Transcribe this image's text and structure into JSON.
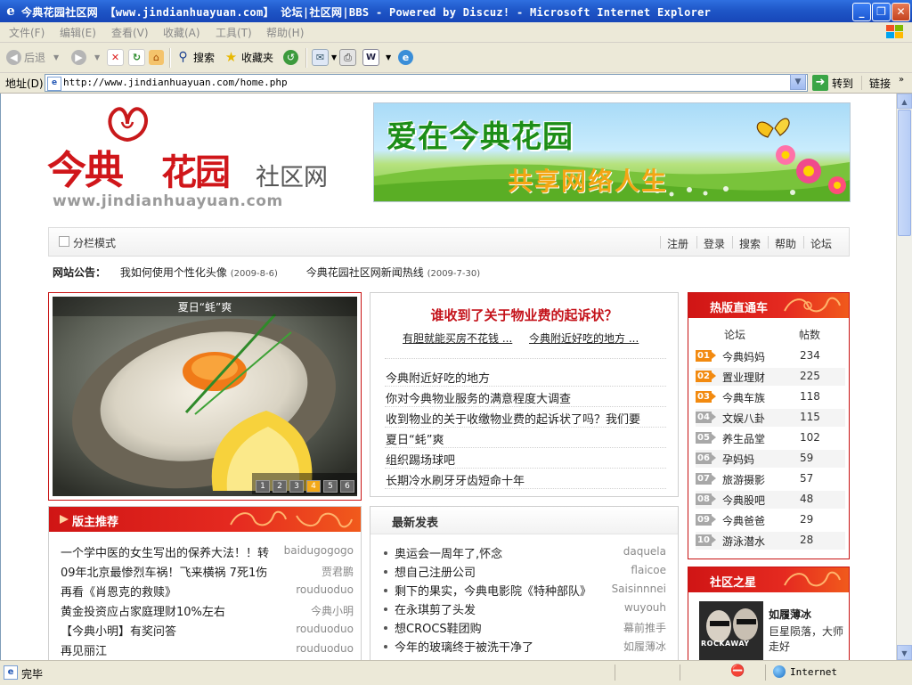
{
  "window": {
    "title": "今典花园社区网 【www.jindianhuayuan.com】 论坛|社区网|BBS - Powered by Discuz! - Microsoft Internet Explorer",
    "min_glyph": "_",
    "max_glyph": "❐",
    "close_glyph": "✕"
  },
  "menu": [
    "文件(F)",
    "编辑(E)",
    "查看(V)",
    "收藏(A)",
    "工具(T)",
    "帮助(H)"
  ],
  "toolbar": {
    "back": "后退",
    "search": "搜索",
    "favorites": "收藏夹"
  },
  "address": {
    "label": "地址(D)",
    "url": "http://www.jindianhuayuan.com/home.php",
    "go": "转到",
    "links": "链接"
  },
  "site": {
    "logo_main": "今典",
    "logo_main2": "花园",
    "logo_sub": "社区网",
    "logo_url": "www.jindianhuayuan.com",
    "banner_top": "爱在今典花园",
    "banner_bottom": "共享网络人生",
    "nav": {
      "mode": "分栏模式",
      "links": [
        "注册",
        "登录",
        "搜索",
        "帮助",
        "论坛"
      ]
    },
    "notice": {
      "label": "网站公告：",
      "items": [
        {
          "text": "我如何使用个性化头像",
          "date": "(2009-8-6)"
        },
        {
          "text": "今典花园社区网新闻热线",
          "date": "(2009-7-30)"
        }
      ]
    },
    "slideshow": {
      "caption": "夏日“蚝”爽",
      "pages": [
        "1",
        "2",
        "3",
        "4",
        "5",
        "6"
      ],
      "active": 4
    },
    "headline": {
      "title": "谁收到了关于物业费的起诉状？",
      "sub": [
        "有胆就能买房不花钱 ...",
        "今典附近好吃的地方 ..."
      ],
      "list": [
        "今典附近好吃的地方",
        "你对今典物业服务的满意程度大调查",
        "收到物业的关于收缴物业费的起诉状了吗？我们要",
        "夏日“蚝”爽",
        "组织踢场球吧",
        "长期冷水刷牙牙齿短命十年"
      ]
    },
    "hot": {
      "title": "热版直通车",
      "col_forum": "论坛",
      "col_posts": "帖数",
      "rows": [
        {
          "rank": "01",
          "name": "今典妈妈",
          "count": "234"
        },
        {
          "rank": "02",
          "name": "置业理财",
          "count": "225"
        },
        {
          "rank": "03",
          "name": "今典车族",
          "count": "118"
        },
        {
          "rank": "04",
          "name": "文娱八卦",
          "count": "115"
        },
        {
          "rank": "05",
          "name": "养生品堂",
          "count": "102"
        },
        {
          "rank": "06",
          "name": "孕妈妈",
          "count": "59"
        },
        {
          "rank": "07",
          "name": "旅游摄影",
          "count": "57"
        },
        {
          "rank": "08",
          "name": "今典股吧",
          "count": "48"
        },
        {
          "rank": "09",
          "name": "今典爸爸",
          "count": "29"
        },
        {
          "rank": "10",
          "name": "游泳潜水",
          "count": "28"
        }
      ]
    },
    "moderator": {
      "title": "版主推荐",
      "rows": [
        {
          "title": "一个学中医的女生写出的保养大法！！转",
          "author": "baidugogogo"
        },
        {
          "title": "09年北京最惨烈车祸！飞来横祸 7死1伤",
          "author": "贾君鹏"
        },
        {
          "title": "再看《肖恩克的救赎》",
          "author": "rouduoduo"
        },
        {
          "title": "黄金投资应占家庭理财10%左右",
          "author": "今典小明"
        },
        {
          "title": "【今典小明】有奖问答",
          "author": "rouduoduo"
        },
        {
          "title": "再见丽江",
          "author": "rouduoduo"
        }
      ]
    },
    "latest": {
      "title": "最新发表",
      "rows": [
        {
          "title": "奥运会一周年了,怀念",
          "author": "daquela"
        },
        {
          "title": "想自己注册公司",
          "author": "flaicoe"
        },
        {
          "title": "剩下的果实，今典电影院《特种部队》",
          "author": "Saisinnnei"
        },
        {
          "title": "在永琪剪了头发",
          "author": "wuyouh"
        },
        {
          "title": "想CROCS鞋团购",
          "author": "幕前推手"
        },
        {
          "title": "今年的玻璃终于被洗干净了",
          "author": "如履薄冰"
        }
      ]
    },
    "star": {
      "title": "社区之星",
      "name": "如履薄冰",
      "desc": "巨星陨落，大师走好",
      "img_text": "ROCKAWAY"
    }
  },
  "status": {
    "done": "完毕",
    "zone": "Internet"
  },
  "colors": {
    "accent_red": "#c81212",
    "title_blue": "#1f57c8",
    "link_blue": "#0a3c8c"
  }
}
